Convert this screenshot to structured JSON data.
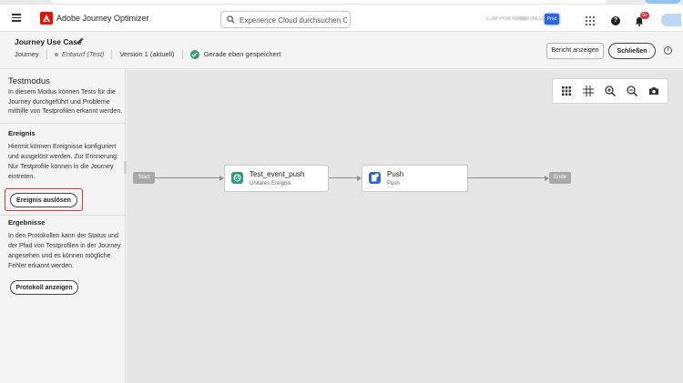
{
  "app": {
    "name": "Adobe Journey Optimizer",
    "search_placeholder": "Experience Cloud durchsuchen Ctr...",
    "org_name": "CJM Prod NLD2",
    "sandbox_name": "Prod (NLD2)",
    "sandbox_badge": "Prod",
    "notification_count": "9+"
  },
  "journey": {
    "title": "Journey Use Case",
    "type_label": "Journey",
    "status": "Entwurf (Test)",
    "version": "Version 1 (aktuell)",
    "save_status": "Gerade eben gespeichert",
    "report_button": "Bericht anzeigen",
    "close_button": "Schließen"
  },
  "test_panel": {
    "title": "Testmodus",
    "description": "In diesem Modus können Tests für die Journey durchgeführt und Probleme mithilfe von Testprofilen erkannt werden.",
    "event_section": {
      "title": "Ereignis",
      "text": "Hiermit können Ereignisse konfiguriert und ausgelöst werden. Zur Erinnerung: Nur Testprofile  können in die Journey eintreten.",
      "button": "Ereignis auslösen"
    },
    "results_section": {
      "title": "Ergebnisse",
      "text": "In den Protokollen kann der Status und der Pfad von Testprofilen in der Journey angesehen und es können mögliche Fehler erkannt werden.",
      "button": "Protokoll anzeigen"
    }
  },
  "canvas": {
    "start_label": "Start",
    "end_label": "Ende",
    "nodes": [
      {
        "title": "Test_event_push",
        "subtitle": "Unitäres Ereignis",
        "icon": "event-globe-icon",
        "color": "#2d9d78"
      },
      {
        "title": "Push",
        "subtitle": "Push",
        "icon": "push-notification-icon",
        "color": "#2a64e3"
      }
    ],
    "toolbar_icons": [
      "grid-icon",
      "crosshair-icon",
      "zoom-in-icon",
      "zoom-out-icon",
      "camera-icon"
    ]
  },
  "colors": {
    "accent": "#2a64e3",
    "success": "#2d9d78",
    "highlight": "#d7373f",
    "adobe_red": "#eb1000"
  }
}
